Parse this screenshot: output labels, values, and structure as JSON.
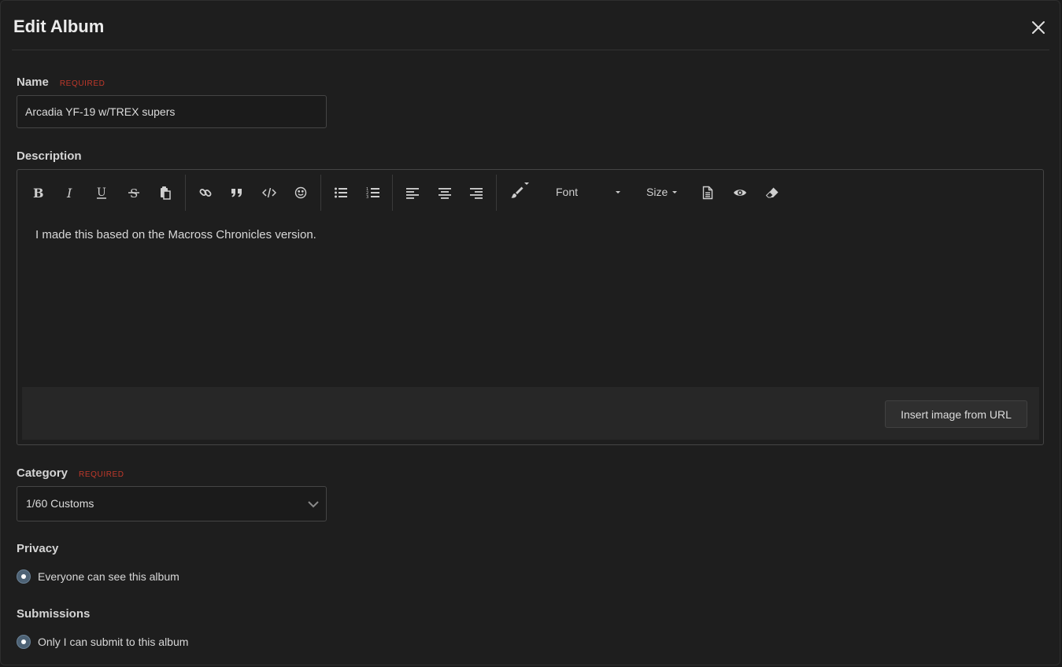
{
  "modal": {
    "title": "Edit Album"
  },
  "name_field": {
    "label": "Name",
    "required_tag": "Required",
    "value": "Arcadia YF-19 w/TREX supers"
  },
  "description": {
    "label": "Description",
    "toolbar": {
      "font_label": "Font",
      "size_label": "Size",
      "icons": [
        "bold-icon",
        "italic-icon",
        "underline-icon",
        "strikethrough-icon",
        "paste-icon",
        "link-icon",
        "quote-icon",
        "code-icon",
        "smiley-icon",
        "bullet-list-icon",
        "numbered-list-icon",
        "align-left-icon",
        "align-center-icon",
        "align-right-icon",
        "paint-brush-icon",
        "document-icon",
        "eye-icon",
        "eraser-icon"
      ]
    },
    "content": "I made this based on the Macross Chronicles version.",
    "insert_image_label": "Insert image from URL"
  },
  "category": {
    "label": "Category",
    "required_tag": "Required",
    "selected": "1/60 Customs"
  },
  "privacy": {
    "label": "Privacy",
    "option": "Everyone can see this album"
  },
  "submissions": {
    "label": "Submissions",
    "option": "Only I can submit to this album"
  },
  "colors": {
    "background": "#1e1e1e",
    "required": "#c0392b",
    "radio_fill": "#4d6275"
  }
}
